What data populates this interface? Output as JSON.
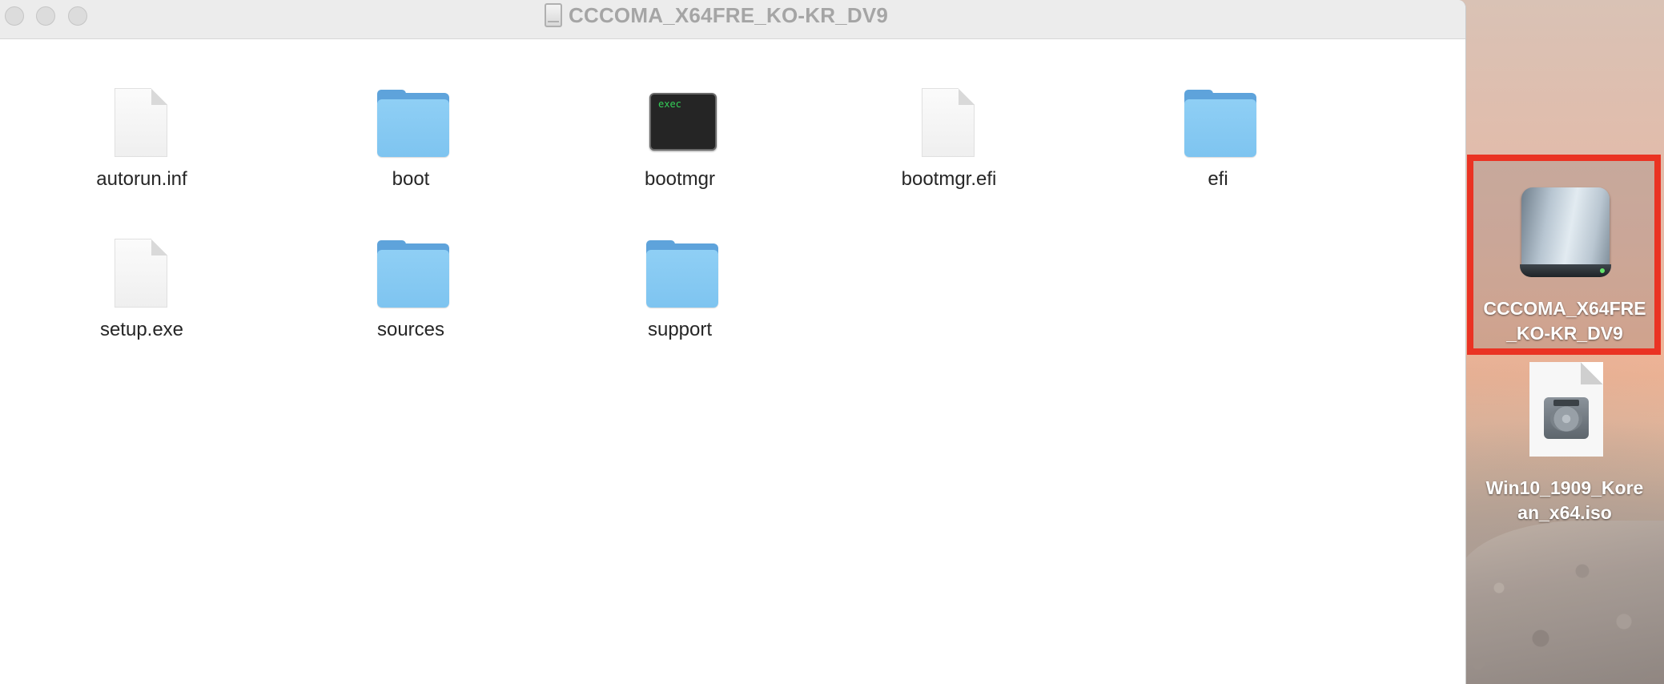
{
  "window": {
    "title": "CCCOMA_X64FRE_KO-KR_DV9",
    "title_icon": "disk-icon"
  },
  "files": [
    {
      "name": "autorun.inf",
      "kind": "document"
    },
    {
      "name": "boot",
      "kind": "folder"
    },
    {
      "name": "bootmgr",
      "kind": "exec",
      "badge": "exec"
    },
    {
      "name": "bootmgr.efi",
      "kind": "document"
    },
    {
      "name": "efi",
      "kind": "folder"
    },
    {
      "name": "setup.exe",
      "kind": "document"
    },
    {
      "name": "sources",
      "kind": "folder"
    },
    {
      "name": "support",
      "kind": "folder"
    }
  ],
  "desktop": {
    "drive": {
      "line1": "CCCOMA_X64FRE",
      "line2": "_KO-KR_DV9",
      "icon": "external-drive-icon",
      "selected": true
    },
    "iso": {
      "line1": "Win10_1909_Kore",
      "line2": "an_x64.iso",
      "icon": "disk-image-icon"
    }
  },
  "colors": {
    "selection_outline": "#ea3323",
    "folder": "#7ec4f0",
    "exec_text": "#34d058"
  }
}
